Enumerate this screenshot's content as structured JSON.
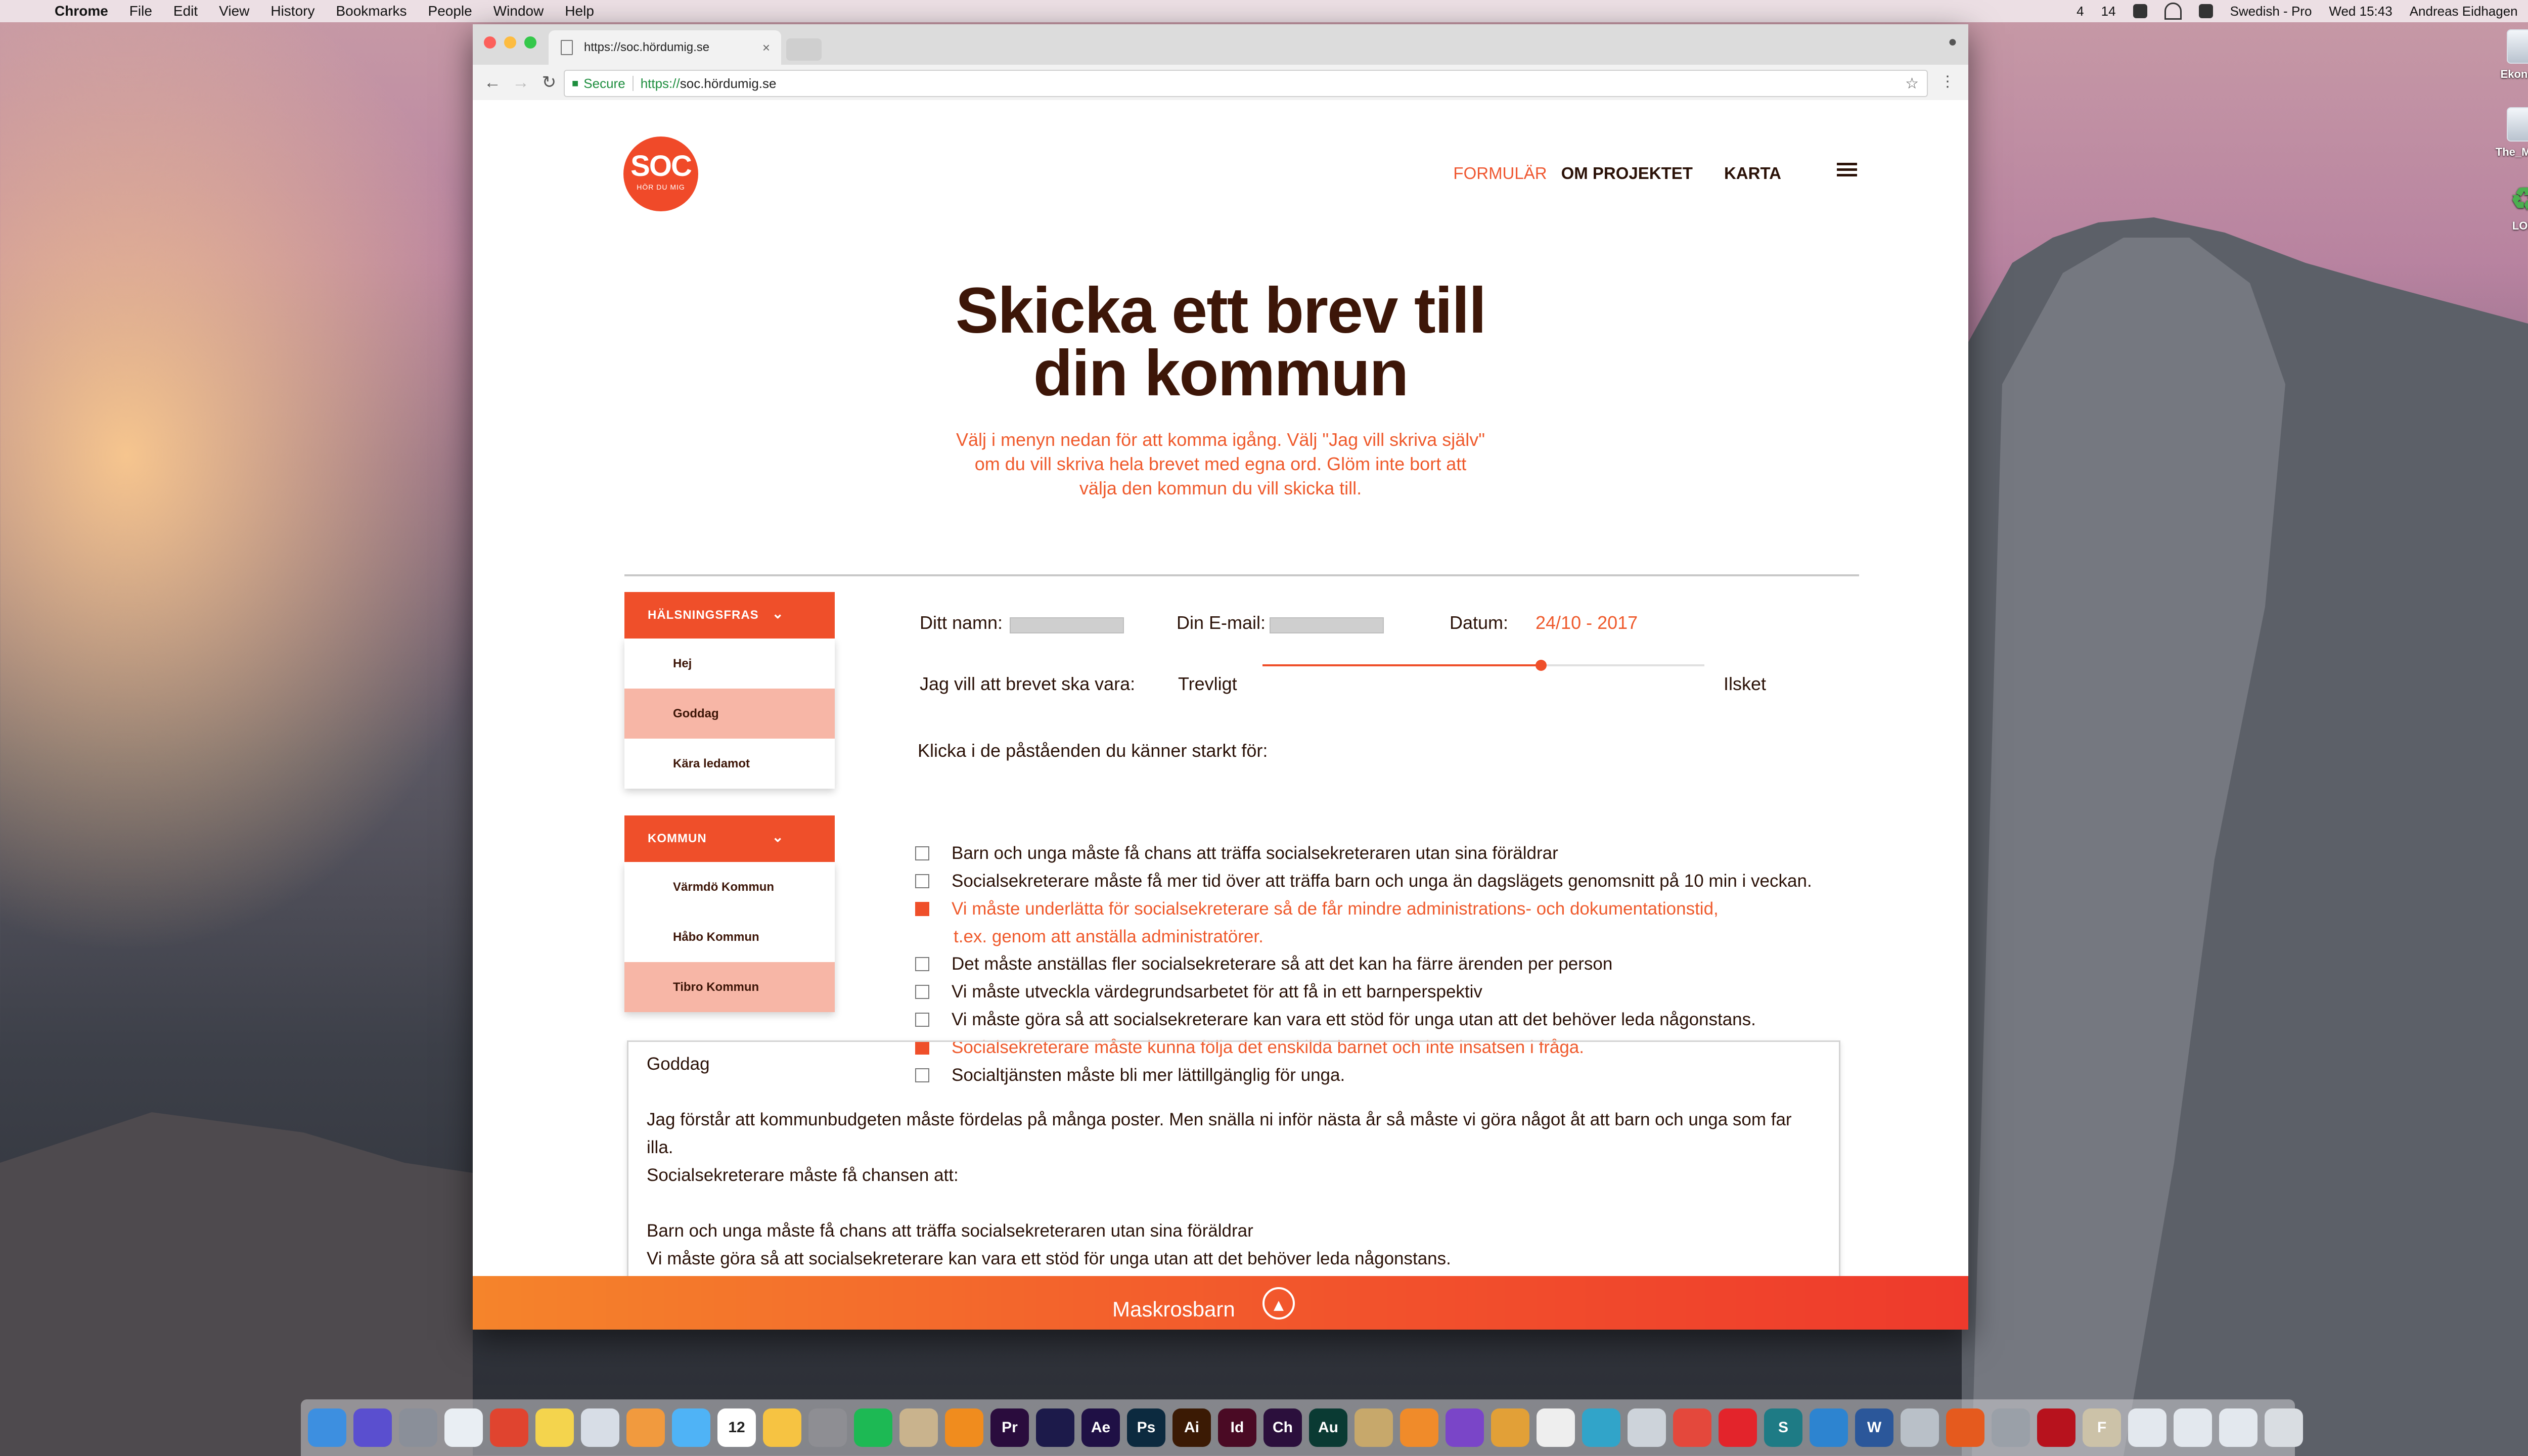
{
  "menubar": {
    "app": "Chrome",
    "items": [
      "File",
      "Edit",
      "View",
      "History",
      "Bookmarks",
      "People",
      "Window",
      "Help"
    ],
    "status": {
      "badge1": "4",
      "badge2": "14",
      "input_source": "Swedish - Pro",
      "clock": "Wed 15:43",
      "user": "Andreas Eidhagen"
    }
  },
  "desktop": {
    "icons": [
      {
        "label": "Ekonomi",
        "icon": "drive-icon"
      },
      {
        "label": "The_Motor",
        "icon": "drive-icon"
      },
      {
        "label": "LOD",
        "icon": "recycle-icon"
      }
    ]
  },
  "browser": {
    "tab_title": "https://soc.hördumig.se",
    "secure_label": "Secure",
    "url_scheme": "https://",
    "url_host": "soc.hördumig.se"
  },
  "site": {
    "logo": {
      "big": "SOC",
      "small": "HÖR DU MIG"
    },
    "nav": [
      "FORMULÄR",
      "OM PROJEKTET",
      "KARTA"
    ],
    "title_line1": "Skicka ett brev till",
    "title_line2": "din kommun",
    "subtitle_line1": "Välj i menyn nedan för att komma igång. Välj \"Jag vill skriva själv\"",
    "subtitle_line2": "om du vill skriva hela brevet med egna ord. Glöm inte bort att",
    "subtitle_line3": "välja den kommun du vill skicka till.",
    "sidebar": {
      "greeting_header": "HÄLSNINGSFRAS",
      "greetings": [
        "Hej",
        "Goddag",
        "Kära ledamot"
      ],
      "selected_greeting": "Goddag",
      "municipality_header": "KOMMUN",
      "municipalities": [
        "Värmdö Kommun",
        "Håbo Kommun",
        "Tibro Kommun"
      ],
      "selected_municipality": "Tibro Kommun"
    },
    "form": {
      "name_label": "Ditt namn:",
      "email_label": "Din E-mail:",
      "date_label": "Datum:",
      "date_value": "24/10 - 2017",
      "tone_label": "Jag vill att brevet ska vara:",
      "tone_min": "Trevligt",
      "tone_max": "Ilsket",
      "tone_level": 0.63,
      "statements_intro": "Klicka i de påståenden du känner starkt för:",
      "statements": [
        {
          "text": "Barn och unga måste få chans att träffa socialsekreteraren utan sina föräldrar",
          "checked": false
        },
        {
          "text": "Socialsekreterare måste få mer tid över att träffa barn och unga än dagslägets genomsnitt på 10 min i veckan.",
          "checked": false
        },
        {
          "text": "Vi måste underlätta för socialsekreterare så de får mindre administrations- och dokumentationstid,",
          "continuation": "t.ex. genom att anställa administratörer.",
          "checked": true
        },
        {
          "text": "Det måste anställas fler socialsekreterare så att det kan ha färre ärenden per person",
          "checked": false
        },
        {
          "text": "Vi måste utveckla värdegrundsarbetet för att få in ett barnperspektiv",
          "checked": false
        },
        {
          "text": "Vi måste göra så att socialsekreterare kan vara ett stöd för unga utan att det behöver leda någonstans.",
          "checked": false
        },
        {
          "text": "Socialsekreterare måste kunna följa det enskilda barnet och inte insatsen i fråga.",
          "checked": true
        },
        {
          "text": "Socialtjänsten måste bli mer lättillgänglig för unga.",
          "checked": false
        }
      ]
    },
    "letter": {
      "greeting": "Goddag",
      "para1_line1": "Jag förstår att kommunbudgeten måste fördelas på många poster. Men snälla ni inför nästa år så måste vi göra något åt att barn och unga som far illa.",
      "para1_line2": "Socialsekreterare måste få chansen att:",
      "item1": "Barn och unga måste få chans att träffa socialsekreteraren utan sina föräldrar",
      "item2": "Vi måste göra så att socialsekreterare kan vara ett stöd för unga utan att det behöver leda någonstans."
    },
    "footer": {
      "brand": "Maskrosbarn"
    }
  },
  "dock": {
    "apps": [
      {
        "name": "finder-icon",
        "color": "#3d8fe0",
        "glyph": ""
      },
      {
        "name": "siri-icon",
        "color": "#5a4fcf",
        "glyph": ""
      },
      {
        "name": "launchpad-icon",
        "color": "#8a8f99",
        "glyph": ""
      },
      {
        "name": "safari-icon",
        "color": "#e9eef3",
        "glyph": ""
      },
      {
        "name": "chrome-icon",
        "color": "#e0442f",
        "glyph": ""
      },
      {
        "name": "notes-icon",
        "color": "#f4d44d",
        "glyph": ""
      },
      {
        "name": "preview-icon",
        "color": "#d7dde6",
        "glyph": ""
      },
      {
        "name": "photos-icon",
        "color": "#f19a3e",
        "glyph": ""
      },
      {
        "name": "messages-icon",
        "color": "#4fb3f6",
        "glyph": ""
      },
      {
        "name": "calendar-icon",
        "color": "#ffffff",
        "glyph": "12"
      },
      {
        "name": "notepad-icon",
        "color": "#f6c342",
        "glyph": ""
      },
      {
        "name": "system-preferences-icon",
        "color": "#8e8e93",
        "glyph": ""
      },
      {
        "name": "spotify-icon",
        "color": "#1db954",
        "glyph": ""
      },
      {
        "name": "script-icon",
        "color": "#c9b38d",
        "glyph": ""
      },
      {
        "name": "vlc-icon",
        "color": "#f08c1e",
        "glyph": ""
      },
      {
        "name": "premiere-icon",
        "color": "#2a0c3d",
        "glyph": "Pr"
      },
      {
        "name": "media-encoder-icon",
        "color": "#1c1a4a",
        "glyph": ""
      },
      {
        "name": "after-effects-icon",
        "color": "#1f1045",
        "glyph": "Ae"
      },
      {
        "name": "photoshop-icon",
        "color": "#0c2a3f",
        "glyph": "Ps"
      },
      {
        "name": "illustrator-icon",
        "color": "#3b1a04",
        "glyph": "Ai"
      },
      {
        "name": "indesign-icon",
        "color": "#4a0a24",
        "glyph": "Id"
      },
      {
        "name": "character-animator-icon",
        "color": "#2b0f3c",
        "glyph": "Ch"
      },
      {
        "name": "audition-icon",
        "color": "#0a3a33",
        "glyph": "Au"
      },
      {
        "name": "package-icon",
        "color": "#c7a86b",
        "glyph": ""
      },
      {
        "name": "books-icon",
        "color": "#f08b2a",
        "glyph": ""
      },
      {
        "name": "omnifocus-icon",
        "color": "#7a45c8",
        "glyph": ""
      },
      {
        "name": "tasks-icon",
        "color": "#e2a037",
        "glyph": ""
      },
      {
        "name": "typewriter-icon",
        "color": "#eeeeee",
        "glyph": ""
      },
      {
        "name": "search-app-icon",
        "color": "#31a4c9",
        "glyph": ""
      },
      {
        "name": "screenshot-icon",
        "color": "#cdd3da",
        "glyph": ""
      },
      {
        "name": "todoist-icon",
        "color": "#e4483c",
        "glyph": ""
      },
      {
        "name": "power-icon",
        "color": "#e3242b",
        "glyph": ""
      },
      {
        "name": "scribd-icon",
        "color": "#1e7b85",
        "glyph": "S"
      },
      {
        "name": "flow-icon",
        "color": "#2d84d0",
        "glyph": ""
      },
      {
        "name": "word-icon",
        "color": "#2b579a",
        "glyph": "W"
      },
      {
        "name": "preview-scan-icon",
        "color": "#b9c0c8",
        "glyph": ""
      },
      {
        "name": "fire-icon",
        "color": "#e55a1e",
        "glyph": ""
      },
      {
        "name": "rocket-icon",
        "color": "#9aa0a8",
        "glyph": ""
      },
      {
        "name": "acrobat-icon",
        "color": "#b7121d",
        "glyph": ""
      },
      {
        "name": "text-editor-icon",
        "color": "#ccc2a8",
        "glyph": "F"
      },
      {
        "name": "folder-icon",
        "color": "#e3e8ee",
        "glyph": ""
      },
      {
        "name": "folder-icon",
        "color": "#e3e8ee",
        "glyph": ""
      },
      {
        "name": "folder-icon",
        "color": "#e3e8ee",
        "glyph": ""
      },
      {
        "name": "trash-icon",
        "color": "#d9dde2",
        "glyph": ""
      }
    ]
  },
  "colors": {
    "accent": "#ef4f2a",
    "dark_text": "#3d1608",
    "secondary_accent": "#ef5a2c"
  }
}
